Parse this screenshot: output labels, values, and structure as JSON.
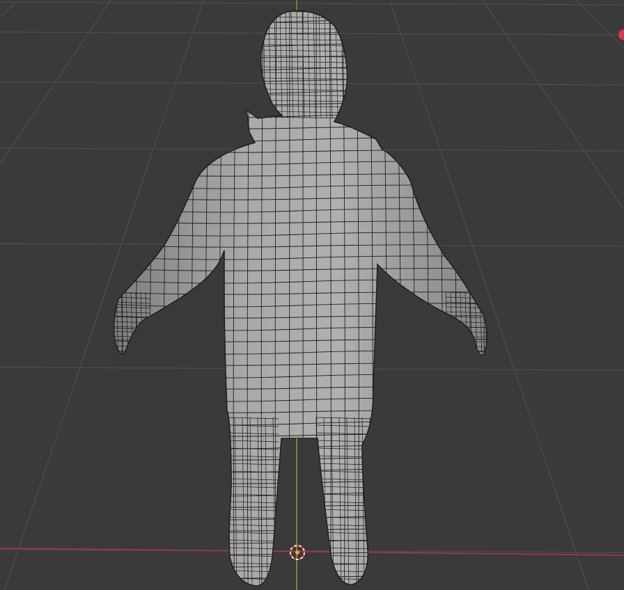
{
  "app": "3D Viewport",
  "colors": {
    "background": "#3a3a3a",
    "grid": "#4e4e4e",
    "x_axis": "#a8394a",
    "y_axis": "#6f9c30",
    "mesh_fill": "#9e9e9e",
    "mesh_wire": "#1e1e1e",
    "cursor_outer": "#ffffff",
    "cursor_inner": "#e0453b",
    "gizmo_x": "#d6384f"
  },
  "scene": {
    "object": "character-mesh",
    "view": "back-perspective",
    "shading": "solid",
    "overlay_wireframe": true,
    "grid_floor": true
  },
  "icons": {
    "cursor": "3d-cursor-icon",
    "gizmo": "navigation-gizmo-x-icon"
  }
}
